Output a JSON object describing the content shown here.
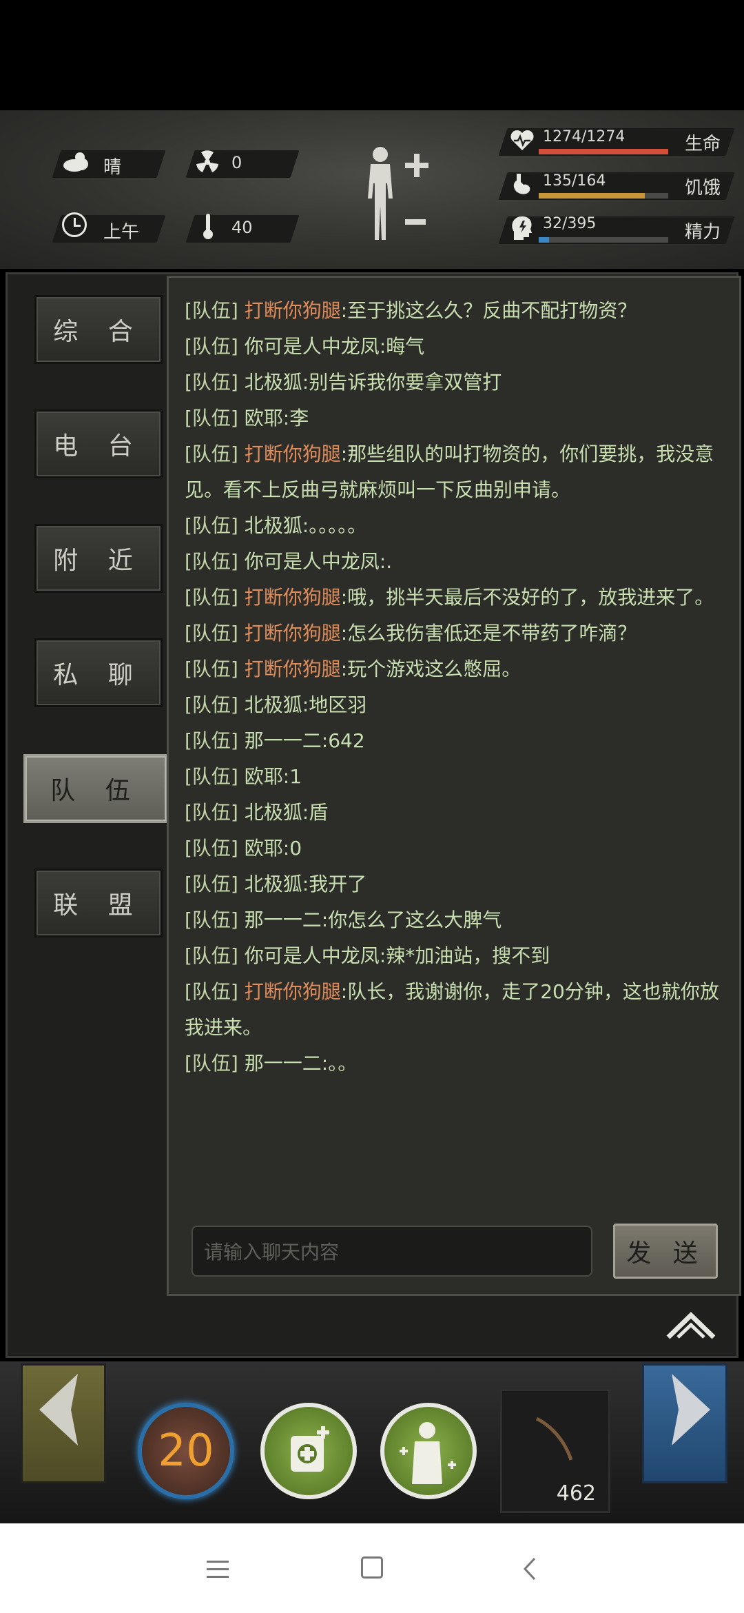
{
  "status": {
    "weather": "晴",
    "radiation": "0",
    "time_of_day": "上午",
    "temperature": "40",
    "life": {
      "value": "1274/1274",
      "label": "生命",
      "fraction": 1.0,
      "color": "#d2503a"
    },
    "hunger": {
      "value": "135/164",
      "label": "饥饿",
      "fraction": 0.82,
      "color": "#c8953a"
    },
    "energy": {
      "value": "32/395",
      "label": "精力",
      "fraction": 0.08,
      "color": "#3a87c8"
    }
  },
  "tabs": [
    "综 合",
    "电 台",
    "附 近",
    "私 聊",
    "队 伍",
    "联 盟"
  ],
  "active_tab": 4,
  "messages": [
    {
      "tag": "[队伍]",
      "name": "打断你狗腿",
      "text": ":至于挑这么久？反曲不配打物资？",
      "hl": true
    },
    {
      "tag": "[队伍]",
      "name": "你可是人中龙凤",
      "text": ":晦气",
      "hl": false
    },
    {
      "tag": "[队伍]",
      "name": "北极狐",
      "text": ":别告诉我你要拿双管打",
      "hl": false
    },
    {
      "tag": "[队伍]",
      "name": "欧耶",
      "text": ":李",
      "hl": false
    },
    {
      "tag": "[队伍]",
      "name": "打断你狗腿",
      "text": ":那些组队的叫打物资的，你们要挑，我没意见。看不上反曲弓就麻烦叫一下反曲别申请。",
      "hl": true
    },
    {
      "tag": "[队伍]",
      "name": "北极狐",
      "text": ":。。。。。",
      "hl": false
    },
    {
      "tag": "[队伍]",
      "name": "你可是人中龙凤",
      "text": ":.",
      "hl": false
    },
    {
      "tag": "[队伍]",
      "name": "打断你狗腿",
      "text": ":哦，挑半天最后不没好的了，放我进来了。",
      "hl": true
    },
    {
      "tag": "[队伍]",
      "name": "打断你狗腿",
      "text": ":怎么我伤害低还是不带药了咋滴？",
      "hl": true
    },
    {
      "tag": "[队伍]",
      "name": "打断你狗腿",
      "text": ":玩个游戏这么憋屈。",
      "hl": true
    },
    {
      "tag": "[队伍]",
      "name": "北极狐",
      "text": ":地区羽",
      "hl": false
    },
    {
      "tag": "[队伍]",
      "name": "那一一二",
      "text": ":642",
      "hl": false
    },
    {
      "tag": "[队伍]",
      "name": "欧耶",
      "text": ":1",
      "hl": false
    },
    {
      "tag": "[队伍]",
      "name": "北极狐",
      "text": ":盾",
      "hl": false
    },
    {
      "tag": "[队伍]",
      "name": "欧耶",
      "text": ":0",
      "hl": false
    },
    {
      "tag": "[队伍]",
      "name": "北极狐",
      "text": ":我开了",
      "hl": false
    },
    {
      "tag": "[队伍]",
      "name": "那一一二",
      "text": ":你怎么了这么大脾气",
      "hl": false
    },
    {
      "tag": "[队伍]",
      "name": "你可是人中龙凤",
      "text": ":辣*加油站，搜不到",
      "hl": false
    },
    {
      "tag": "[队伍]",
      "name": "打断你狗腿",
      "text": ":队长，我谢谢你，走了20分钟，这也就你放我进来。",
      "hl": true
    },
    {
      "tag": "[队伍]",
      "name": "那一一二",
      "text": ":。。",
      "hl": false
    }
  ],
  "input": {
    "placeholder": "请输入聊天内容"
  },
  "send_label": "发 送",
  "skills": {
    "level_badge": "20",
    "item_count": "462"
  },
  "colors": {
    "name_highlight": "#e08d5c",
    "chat_text": "#c8dfb0"
  }
}
